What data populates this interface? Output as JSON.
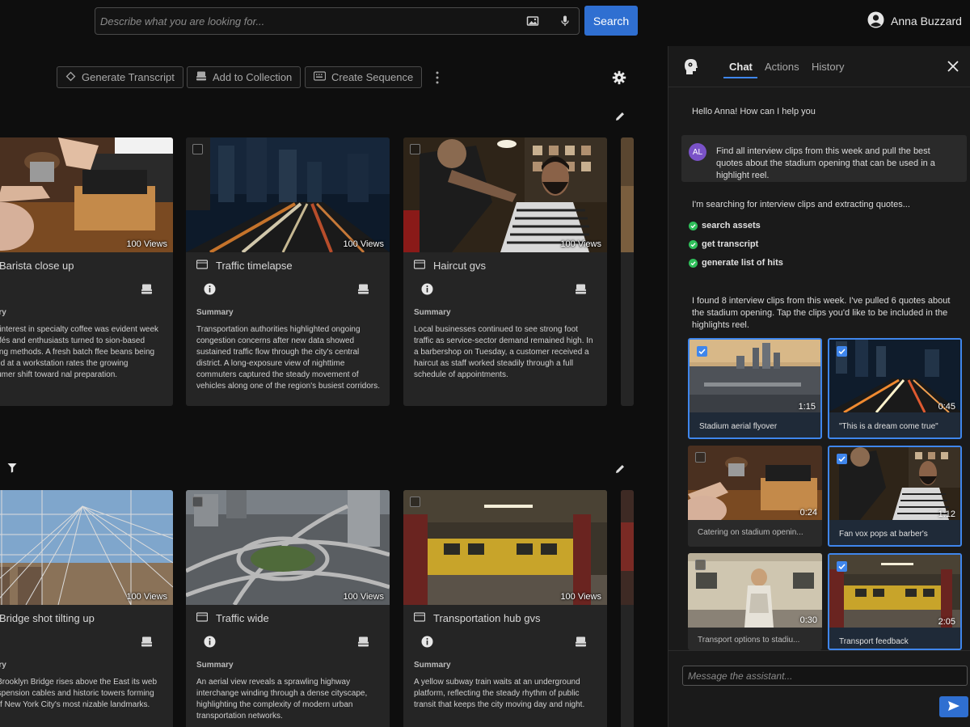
{
  "search": {
    "placeholder": "Describe what you are looking for...",
    "button": "Search"
  },
  "user": {
    "name": "Anna Buzzard"
  },
  "toolbar": {
    "generate_transcript": "Generate Transcript",
    "add_to_collection": "Add to Collection",
    "create_sequence": "Create Sequence"
  },
  "cards_row1": [
    {
      "title": "Barista close up",
      "views": "100 Views",
      "summary_label": "mmary",
      "summary": "ge in interest in specialty coffee was evident week as cafés and enthusiasts turned to sion-based brewing methods. A fresh batch ffee beans being ground at a workstation rates the growing consumer shift toward nal preparation."
    },
    {
      "title": "Traffic timelapse",
      "views": "100 Views",
      "summary_label": "Summary",
      "summary": "Transportation authorities highlighted ongoing congestion concerns after new data showed sustained traffic flow through the city's central district. A long-exposure view of nighttime commuters captured the steady movement of vehicles along one of the region's busiest corridors."
    },
    {
      "title": "Haircut gvs",
      "views": "100 Views",
      "summary_label": "Summary",
      "summary": "Local businesses continued to see strong foot traffic as service-sector demand remained high. In a barbershop on Tuesday, a customer received a haircut as staff worked steadily through a full schedule of appointments."
    }
  ],
  "cards_row2": [
    {
      "title": "Bridge shot tilting up",
      "views": "100 Views",
      "summary_label": "mmary",
      "summary": "onic Brooklyn Bridge rises above the East its web of suspension cables and historic towers forming one of New York City's most nizable landmarks."
    },
    {
      "title": "Traffic wide",
      "views": "100 Views",
      "summary_label": "Summary",
      "summary": "An aerial view reveals a sprawling highway interchange winding through a dense cityscape, highlighting the complexity of modern urban transportation networks."
    },
    {
      "title": "Transportation hub gvs",
      "views": "100 Views",
      "summary_label": "Summary",
      "summary": "A yellow subway train waits at an underground platform, reflecting the steady rhythm of public transit that keeps the city moving day and night."
    }
  ],
  "chat": {
    "tabs": [
      "Chat",
      "Actions",
      "History"
    ],
    "active_tab": "Chat",
    "greeting": "Hello Anna! How can I help you",
    "user_initials": "AL",
    "user_message": "Find all interview clips from this week and pull the best quotes about the stadium opening that can be used in a highlight reel.",
    "searching": "I'm searching for interview clips and extracting quotes...",
    "steps": [
      "search assets",
      "get transcript",
      "generate list of hits"
    ],
    "result": "I found 8 interview clips from this week. I've pulled 6 quotes about the stadium opening. Tap the clips you'd like to be included in the highlights reel.",
    "clips": [
      {
        "label": "Stadium aerial flyover",
        "duration": "1:15",
        "selected": true
      },
      {
        "label": "\"This is a dream come true\"",
        "duration": "0:45",
        "selected": true
      },
      {
        "label": "Catering on stadium openin...",
        "duration": "0:24",
        "selected": false
      },
      {
        "label": "Fan vox pops at barber's",
        "duration": "1:12",
        "selected": true
      },
      {
        "label": "Transport options to stadiu...",
        "duration": "0:30",
        "selected": false
      },
      {
        "label": "Transport feedback",
        "duration": "2:05",
        "selected": true
      }
    ],
    "composer_placeholder": "Message the assistant..."
  },
  "colors": {
    "accent": "#2f6fd1",
    "selection": "#3f86ec",
    "success": "#2fbf5a",
    "avatar": "#7a52c8"
  }
}
